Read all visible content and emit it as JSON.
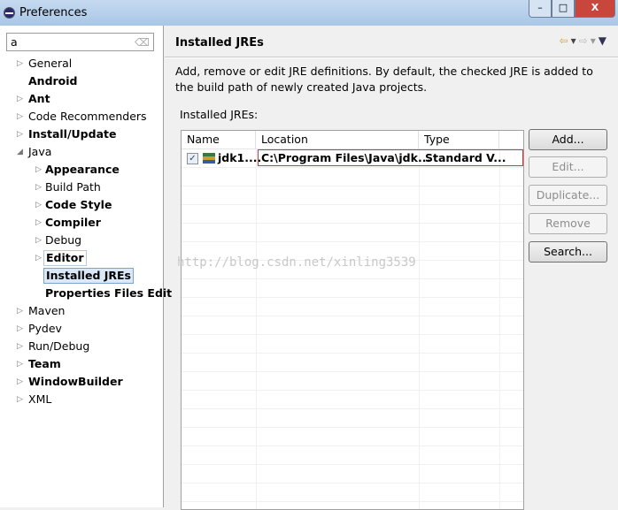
{
  "window": {
    "title": "Preferences",
    "min": "–",
    "max": "□",
    "close": "X"
  },
  "search": {
    "value": "a"
  },
  "tree": [
    {
      "label": "General",
      "level": 0,
      "arrow": "▷",
      "bold": false
    },
    {
      "label": "Android",
      "level": 0,
      "arrow": "",
      "bold": true
    },
    {
      "label": "Ant",
      "level": 0,
      "arrow": "▷",
      "bold": true
    },
    {
      "label": "Code Recommenders",
      "level": 0,
      "arrow": "▷",
      "bold": false
    },
    {
      "label": "Install/Update",
      "level": 0,
      "arrow": "▷",
      "bold": true
    },
    {
      "label": "Java",
      "level": 0,
      "arrow": "◢",
      "bold": false
    },
    {
      "label": "Appearance",
      "level": 1,
      "arrow": "▷",
      "bold": true
    },
    {
      "label": "Build Path",
      "level": 1,
      "arrow": "▷",
      "bold": false
    },
    {
      "label": "Code Style",
      "level": 1,
      "arrow": "▷",
      "bold": true
    },
    {
      "label": "Compiler",
      "level": 1,
      "arrow": "▷",
      "bold": true
    },
    {
      "label": "Debug",
      "level": 1,
      "arrow": "▷",
      "bold": false
    },
    {
      "label": "Editor",
      "level": 1,
      "arrow": "▷",
      "bold": true,
      "state": "boxed"
    },
    {
      "label": "Installed JREs",
      "level": 1,
      "arrow": "",
      "bold": true,
      "state": "selected"
    },
    {
      "label": "Properties Files Edit",
      "level": 1,
      "arrow": "",
      "bold": true
    },
    {
      "label": "Maven",
      "level": 0,
      "arrow": "▷",
      "bold": false
    },
    {
      "label": "Pydev",
      "level": 0,
      "arrow": "▷",
      "bold": false
    },
    {
      "label": "Run/Debug",
      "level": 0,
      "arrow": "▷",
      "bold": false
    },
    {
      "label": "Team",
      "level": 0,
      "arrow": "▷",
      "bold": true
    },
    {
      "label": "WindowBuilder",
      "level": 0,
      "arrow": "▷",
      "bold": true
    },
    {
      "label": "XML",
      "level": 0,
      "arrow": "▷",
      "bold": false
    }
  ],
  "page": {
    "title": "Installed JREs",
    "description": "Add, remove or edit JRE definitions. By default, the checked JRE is added to the build path of newly created Java projects.",
    "table_label": "Installed JREs:"
  },
  "table": {
    "columns": [
      "Name",
      "Location",
      "Type"
    ],
    "rows": [
      {
        "name": "jdk1....",
        "location": "C:\\Program Files\\Java\\jdk...",
        "type": "Standard V...",
        "checked": true
      }
    ]
  },
  "buttons": {
    "add": "Add...",
    "edit": "Edit...",
    "duplicate": "Duplicate...",
    "remove": "Remove",
    "search": "Search..."
  },
  "watermark": "http://blog.csdn.net/xinling3539"
}
